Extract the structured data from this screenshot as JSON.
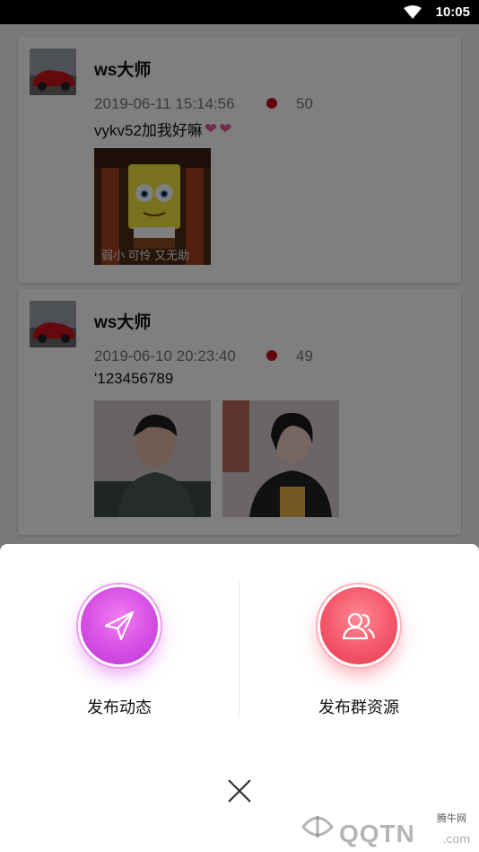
{
  "status_bar": {
    "time": "10:05"
  },
  "posts": [
    {
      "username": "ws大师",
      "timestamp": "2019-06-11 15:14:56",
      "count": "50",
      "text": "vykv52加我好嘛",
      "images": [
        "spongebob-meme",
        "image"
      ],
      "image_caption": "弱小 可怜 又无助"
    },
    {
      "username": "ws大师",
      "timestamp": "2019-06-10 20:23:40",
      "count": "49",
      "text": "'123456789",
      "images": [
        "photo-man",
        "photo-woman"
      ]
    }
  ],
  "sheet": {
    "actions": [
      {
        "label": "发布动态",
        "icon": "send-icon",
        "color": "#d64ee4"
      },
      {
        "label": "发布群资源",
        "icon": "group-icon",
        "color": "#f4566a"
      }
    ],
    "close_icon": "close-icon"
  },
  "watermark": {
    "text": "QQTN",
    "suffix": ".com",
    "small": "腾牛网"
  },
  "colors": {
    "dot": "#c0111c",
    "heart": "#e0569b"
  }
}
